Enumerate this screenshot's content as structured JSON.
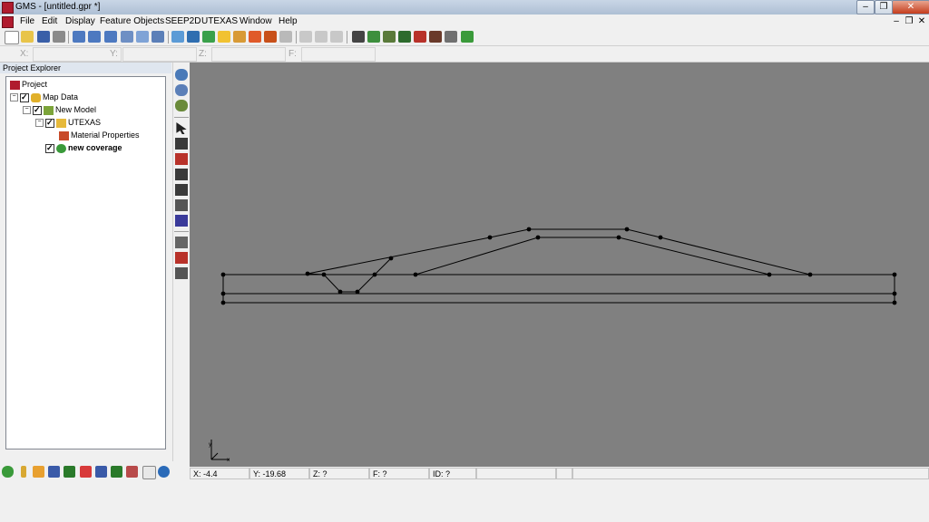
{
  "window": {
    "title": "GMS - [untitled.gpr *]",
    "minimize_glyph": "–",
    "restore_glyph": "❐",
    "close_glyph": "✕"
  },
  "menubar": {
    "items": [
      "File",
      "Edit",
      "Display",
      "Feature Objects",
      "SEEP2D",
      "UTEXAS",
      "Window",
      "Help"
    ],
    "mdi_min": "–",
    "mdi_restore": "❐",
    "mdi_close": "✕"
  },
  "coordbar": {
    "x_label": "X:",
    "x_value": "",
    "y_label": "Y:",
    "y_value": "",
    "z_label": "Z:",
    "z_value": "",
    "f_label": "F:",
    "f_value": ""
  },
  "explorer": {
    "header": "Project Explorer",
    "tree": [
      {
        "label": "Project",
        "icon": "project-icon"
      },
      {
        "label": "Map Data",
        "icon": "map-data-icon"
      },
      {
        "label": "New Model",
        "icon": "conceptual-model-icon"
      },
      {
        "label": "UTEXAS",
        "icon": "utexas-icon"
      },
      {
        "label": "Material Properties",
        "icon": "material-properties-icon"
      },
      {
        "label": "new coverage",
        "icon": "coverage-icon"
      }
    ]
  },
  "status": {
    "x": "X: -4.4",
    "y": "Y: -19.68",
    "z": "Z: ?",
    "f": "F: ?",
    "id": "ID: ?"
  },
  "colors": {
    "canvas_bg": "#808080",
    "geometry_line": "#000000",
    "vertex": "#000000",
    "accent_red": "#b01b2e"
  }
}
